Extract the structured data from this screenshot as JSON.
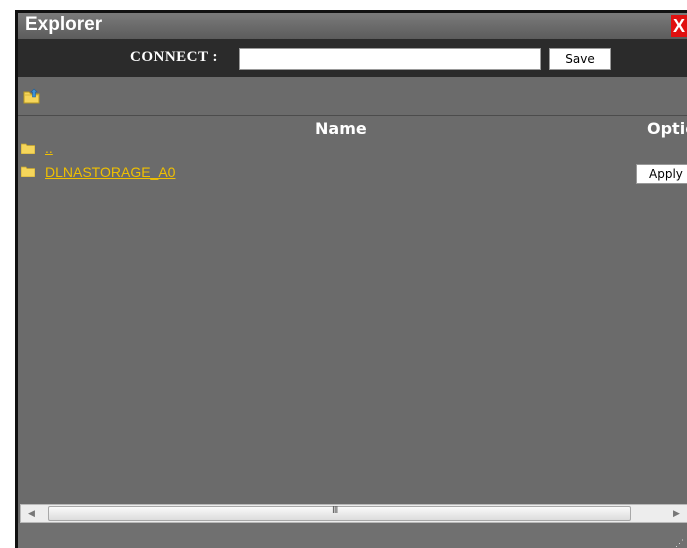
{
  "window": {
    "title": "Explorer",
    "close_label": "X"
  },
  "connect": {
    "label": "CONNECT :",
    "value": "",
    "placeholder": "",
    "save_label": "Save"
  },
  "table": {
    "headers": {
      "name": "Name",
      "options": "Options"
    },
    "rows": [
      {
        "name": "..",
        "apply_label": ""
      },
      {
        "name": "DLNASTORAGE_A0",
        "apply_label": "Apply"
      }
    ]
  },
  "scrollbar": {
    "grip_label": "III"
  },
  "colors": {
    "title_bar": "#6b6b6b",
    "connect_bar": "#2b2b2b",
    "link": "#f0c000",
    "close": "#e01010",
    "panel_bg": "#6b6b6b"
  },
  "icons": [
    "folder-up-icon",
    "folder-icon",
    "close-icon",
    "scroll-left-icon",
    "scroll-right-icon"
  ]
}
